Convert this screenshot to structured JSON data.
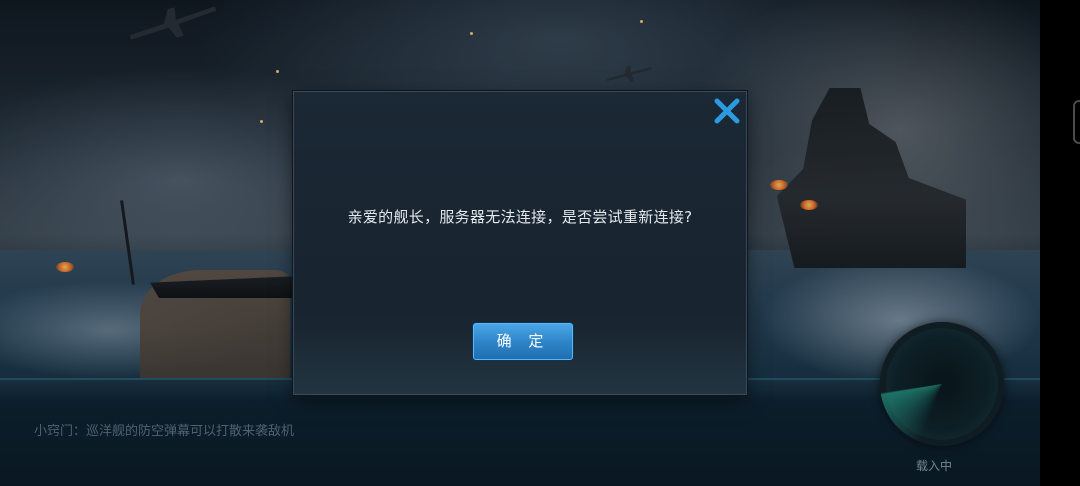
{
  "dialog": {
    "message": "亲爱的舰长，服务器无法连接，是否尝试重新连接?",
    "confirm_label": "确 定",
    "close_icon": "close-icon",
    "close_color": "#2a9be0",
    "button_color": "#2c83c7"
  },
  "loading_screen": {
    "tip_text": "小窍门：巡洋舰的防空弹幕可以打散来袭敌机",
    "status_text": "载入中",
    "radar_icon": "radar-icon"
  }
}
